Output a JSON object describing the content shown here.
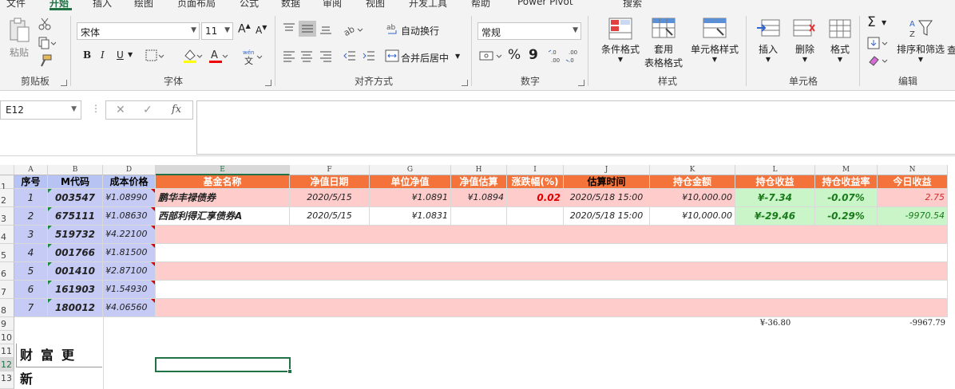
{
  "ribbon": {
    "tabs": [
      "文件",
      "开始",
      "插入",
      "绘图",
      "页面布局",
      "公式",
      "数据",
      "审阅",
      "视图",
      "开发工具",
      "帮助",
      "Power Pivot",
      "搜索"
    ],
    "active_tab": "开始",
    "clipboard": {
      "paste": "粘贴",
      "label": "剪贴板"
    },
    "font": {
      "name": "宋体",
      "size": "11",
      "bold": "B",
      "italic": "I",
      "underline": "U",
      "label": "字体",
      "grow": "A",
      "shrink": "A"
    },
    "alignment": {
      "wrap": "自动换行",
      "merge": "合并后居中",
      "label": "对齐方式"
    },
    "number": {
      "format": "常规",
      "percent": "%",
      "comma": "9",
      "label": "数字"
    },
    "styles": {
      "conditional": "条件格式",
      "table_line1": "套用",
      "table_line2": "表格格式",
      "cell_styles": "单元格样式",
      "label": "样式"
    },
    "cells": {
      "insert": "插入",
      "delete": "删除",
      "format": "格式",
      "label": "单元格"
    },
    "editing": {
      "sort": "排序和筛选",
      "find": "查",
      "sum": "Σ",
      "label": "编辑"
    }
  },
  "formula_bar": {
    "name_box": "E12",
    "cancel": "✕",
    "enter": "✓",
    "fx": "fx",
    "value": ""
  },
  "columns": [
    {
      "letter": "A"
    },
    {
      "letter": "B"
    },
    {
      "letter": "D"
    },
    {
      "letter": "E"
    },
    {
      "letter": "F"
    },
    {
      "letter": "G"
    },
    {
      "letter": "H"
    },
    {
      "letter": "I"
    },
    {
      "letter": "J"
    },
    {
      "letter": "K"
    },
    {
      "letter": "L"
    },
    {
      "letter": "M"
    },
    {
      "letter": "N"
    }
  ],
  "rows": [
    "1",
    "2",
    "3",
    "4",
    "5",
    "6",
    "7",
    "8",
    "9",
    "10",
    "11",
    "12",
    "13"
  ],
  "headers": [
    "序号",
    "M代码",
    "成本价格",
    "基金名称",
    "净值日期",
    "单位净值",
    "净值估算",
    "涨跌幅(%)",
    "估算时间",
    "持仓金额",
    "持仓收益",
    "持仓收益率",
    "今日收益"
  ],
  "data_rows": [
    {
      "no": "1",
      "code": "003547",
      "cost": "¥1.08990",
      "name": "鹏华丰禄债券",
      "date": "2020/5/15",
      "nav": "¥1.0891",
      "est": "¥1.0894",
      "chg": "0.02",
      "time": "2020/5/18 15:00",
      "amount": "¥10,000.00",
      "profit": "¥-7.34",
      "rate": "-0.07%",
      "today": "2.75"
    },
    {
      "no": "2",
      "code": "675111",
      "cost": "¥1.08630",
      "name": "西部利得汇享债券A",
      "date": "2020/5/15",
      "nav": "¥1.0831",
      "est": "",
      "chg": "",
      "time": "2020/5/18 15:00",
      "amount": "¥10,000.00",
      "profit": "¥-29.46",
      "rate": "-0.29%",
      "today": "-9970.54"
    },
    {
      "no": "3",
      "code": "519732",
      "cost": "¥4.22100"
    },
    {
      "no": "4",
      "code": "001766",
      "cost": "¥1.81500"
    },
    {
      "no": "5",
      "code": "001410",
      "cost": "¥2.87100"
    },
    {
      "no": "6",
      "code": "161903",
      "cost": "¥1.54930"
    },
    {
      "no": "7",
      "code": "180012",
      "cost": "¥4.06560"
    }
  ],
  "totals": {
    "profit": "¥-36.80",
    "today": "-9967.79"
  },
  "wealth_button": "财富更新"
}
